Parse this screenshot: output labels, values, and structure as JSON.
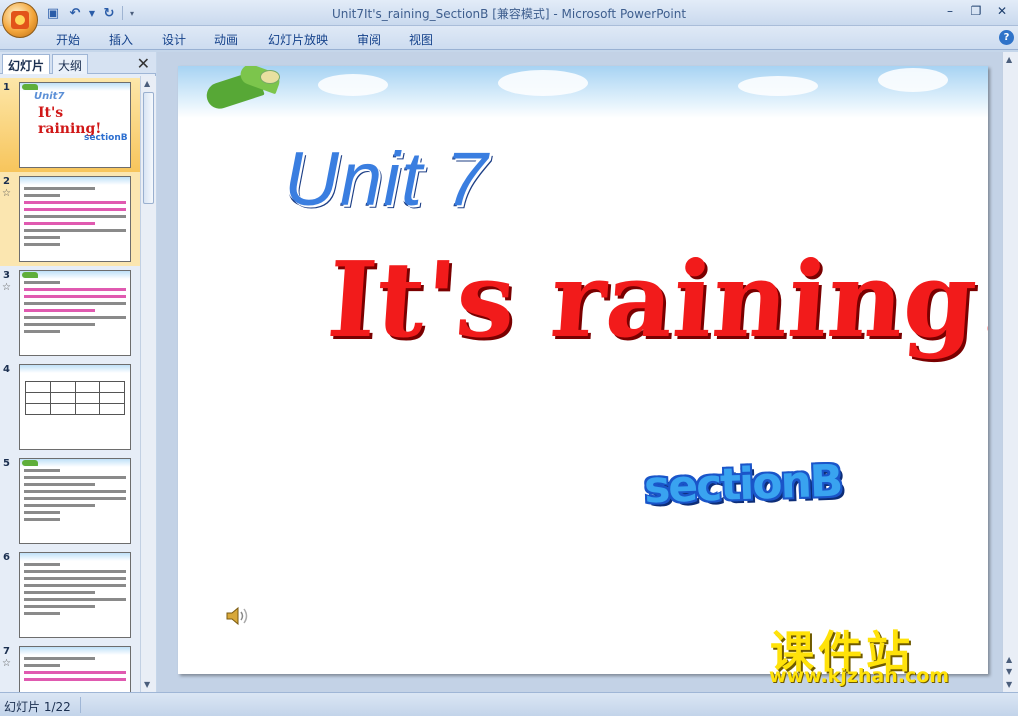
{
  "window": {
    "title": "Unit7It's_raining_SectionB [兼容模式] - Microsoft PowerPoint"
  },
  "ribbon": {
    "tabs": [
      "开始",
      "插入",
      "设计",
      "动画",
      "幻灯片放映",
      "审阅",
      "视图"
    ]
  },
  "pane": {
    "tabs": [
      "幻灯片",
      "大纲"
    ],
    "active_tab": "幻灯片",
    "close_icon": "close-icon",
    "slides": [
      {
        "num": "1",
        "selected": true
      },
      {
        "num": "2",
        "has_animation": true
      },
      {
        "num": "3",
        "has_animation": true
      },
      {
        "num": "4"
      },
      {
        "num": "5"
      },
      {
        "num": "6"
      },
      {
        "num": "7",
        "has_animation": true
      }
    ],
    "thumb1": {
      "unit": "Unit7",
      "title": "It's raining!",
      "section": "sectionB"
    }
  },
  "slide": {
    "unit": "Unit 7",
    "title": "It's raining!",
    "section": "sectionB",
    "sound_icon": "speaker-icon"
  },
  "watermark": {
    "cn": "课件站",
    "url": "www.kjzhan.com"
  },
  "status": {
    "slide_counter": "幻灯片 1/22"
  },
  "colors": {
    "unit_blue": "#3a7ee0",
    "title_red": "#f21b1b",
    "section_blue": "#39a3f0",
    "watermark_yellow": "#ffe20a",
    "selected_thumb": "#f7c55c"
  }
}
